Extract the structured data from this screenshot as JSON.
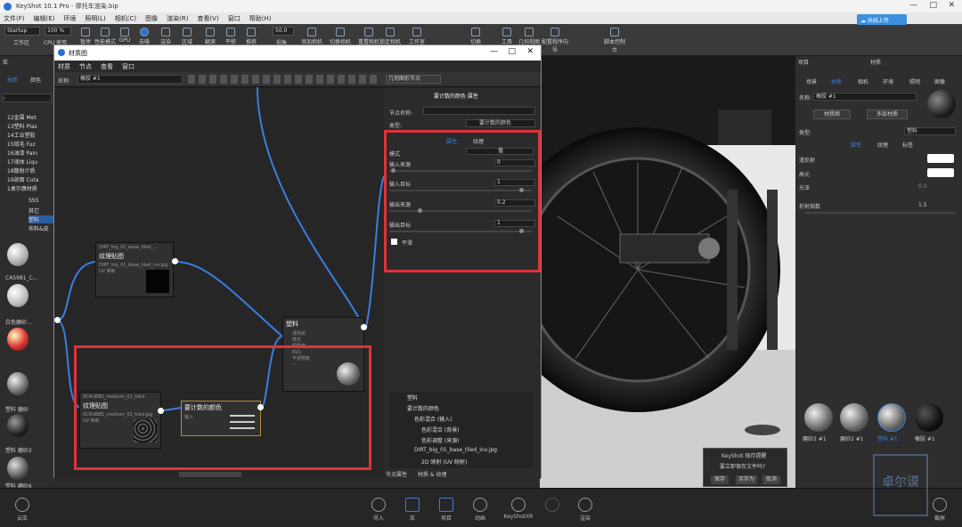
{
  "app": {
    "title": "KeyShot 10.1 Pro - 摩托车渲染.bip"
  },
  "menubar": [
    "文件(F)",
    "编辑(E)",
    "环境",
    "照明(L)",
    "相机(C)",
    "图像",
    "渲染(R)",
    "查看(V)",
    "窗口",
    "帮助(H)"
  ],
  "toolbar": {
    "workspace_value": "Startup",
    "zoom_value": "100 %",
    "fov_value": "50.0",
    "buttons": [
      "工作区",
      "CPU 使用量",
      "暂停",
      "性能模式",
      "GPU",
      "去噪",
      "渲染",
      "区域",
      "翻滚",
      "平移",
      "推移",
      "视角",
      "添加相机",
      "切换相机",
      "重置相机",
      "锁定相机",
      "工作室",
      "切换",
      "工具",
      "几何视图",
      "配置程序向导",
      "脚本控制台"
    ],
    "cloud_label": "共线上传"
  },
  "library": {
    "tabs": [
      "材质",
      "颜色"
    ],
    "tree": [
      "12金属 Met",
      "13塑料 Plas",
      "14工业塑胶",
      "15绒毛 Fuz",
      "16油漆 Pain",
      "17液体 Liqu",
      "18散射介质",
      "19剖面 Cuta",
      "1桌尔廣材质",
      "SSS",
      "其它",
      "塑料",
      "布料&皮"
    ],
    "thumbs": [
      "CAS981_C...",
      "白色磨砂...",
      "塑料 磨砂",
      "塑料 磨砂2",
      "塑料 磨砂6"
    ],
    "footer_label": "云库"
  },
  "graph_window": {
    "title": "材质图",
    "menu": [
      "材质",
      "节点",
      "查看",
      "窗口"
    ],
    "name_label": "名称:",
    "name_value": "橡胶 #1",
    "geometry_node_label": "几何图形节点",
    "nodes": {
      "tex1_header": "DIRT_big_01_base_tiled_...",
      "tex1_title": "纹理贴图",
      "tex1_file": "DIRT_big_01_base_tiled_inv.jpg",
      "tex1_mapping": "UV 映射",
      "tex2_header": "SCRUBBS_medium_02_tiled",
      "tex2_title": "纹理贴图",
      "tex2_file": "SCRUBBS_medium_02_tiled.jpg",
      "tex2_mapping": "UV 映射",
      "curve_title": "要计数的颜色",
      "curve_input": "输入",
      "plastic_title": "塑料",
      "plastic_inputs": [
        "漫反射",
        "高光",
        "粗糙度",
        "凹凸",
        "不透明度",
        "..."
      ]
    }
  },
  "props": {
    "title": "要计数的颜色 属性",
    "node_name_label": "节点名称:",
    "node_name_value": "",
    "type_label": "类型:",
    "type_value": "要计数的颜色",
    "tabs": [
      "属性",
      "纹理"
    ],
    "mode_label": "模式",
    "mode_value": "值",
    "fields": [
      {
        "label": "输入来源",
        "value": "0"
      },
      {
        "label": "输入目标",
        "value": "1"
      },
      {
        "label": "输出来源",
        "value": "0.2"
      },
      {
        "label": "输出目标",
        "value": "1"
      }
    ],
    "smooth_label": "平滑",
    "tree": [
      "塑料",
      "要计数的颜色",
      "色彩混合 (输入)",
      "色彩混合 (背景)",
      "色彩调整 (来源)",
      "DIRT_big_01_base_tiled_inv.jpg",
      "2D 映射 (UV 映射)"
    ],
    "footer_tabs": [
      "节点属性",
      "材质 & 纹理"
    ]
  },
  "right_panel": {
    "header": "项目",
    "section_title": "材质",
    "tabs": [
      "场景",
      "材质",
      "相机",
      "环境",
      "照明",
      "图像"
    ],
    "name_label": "名称:",
    "name_value": "橡胶 #1",
    "graph_button": "材质图",
    "multi_button": "多层材质",
    "type_label": "类型:",
    "type_value": "塑料",
    "subtabs": [
      "属性",
      "纹理",
      "标签"
    ],
    "props": [
      {
        "label": "漫反射"
      },
      {
        "label": "高光"
      },
      {
        "label": "光泽",
        "value": "0.0"
      },
      {
        "label": "折射指数",
        "value": "1.5"
      }
    ],
    "thumbs": [
      "磨砂2 #1",
      "磨砂2 #1",
      "塑料 #1",
      "橡胶 #1"
    ],
    "footer_label": "截屏"
  },
  "dialog": {
    "title": "KeyShot 保存提醒",
    "message": "要立即保存文件吗?",
    "buttons": [
      "保存",
      "另存为",
      "取消"
    ]
  },
  "bottom_bar": [
    "导入",
    "库",
    "项目",
    "动画",
    "KeyShotXR",
    "渲染"
  ],
  "watermark": "卓尔谟",
  "colors": {
    "accent": "#3a7de0",
    "highlight": "#e0323a"
  }
}
